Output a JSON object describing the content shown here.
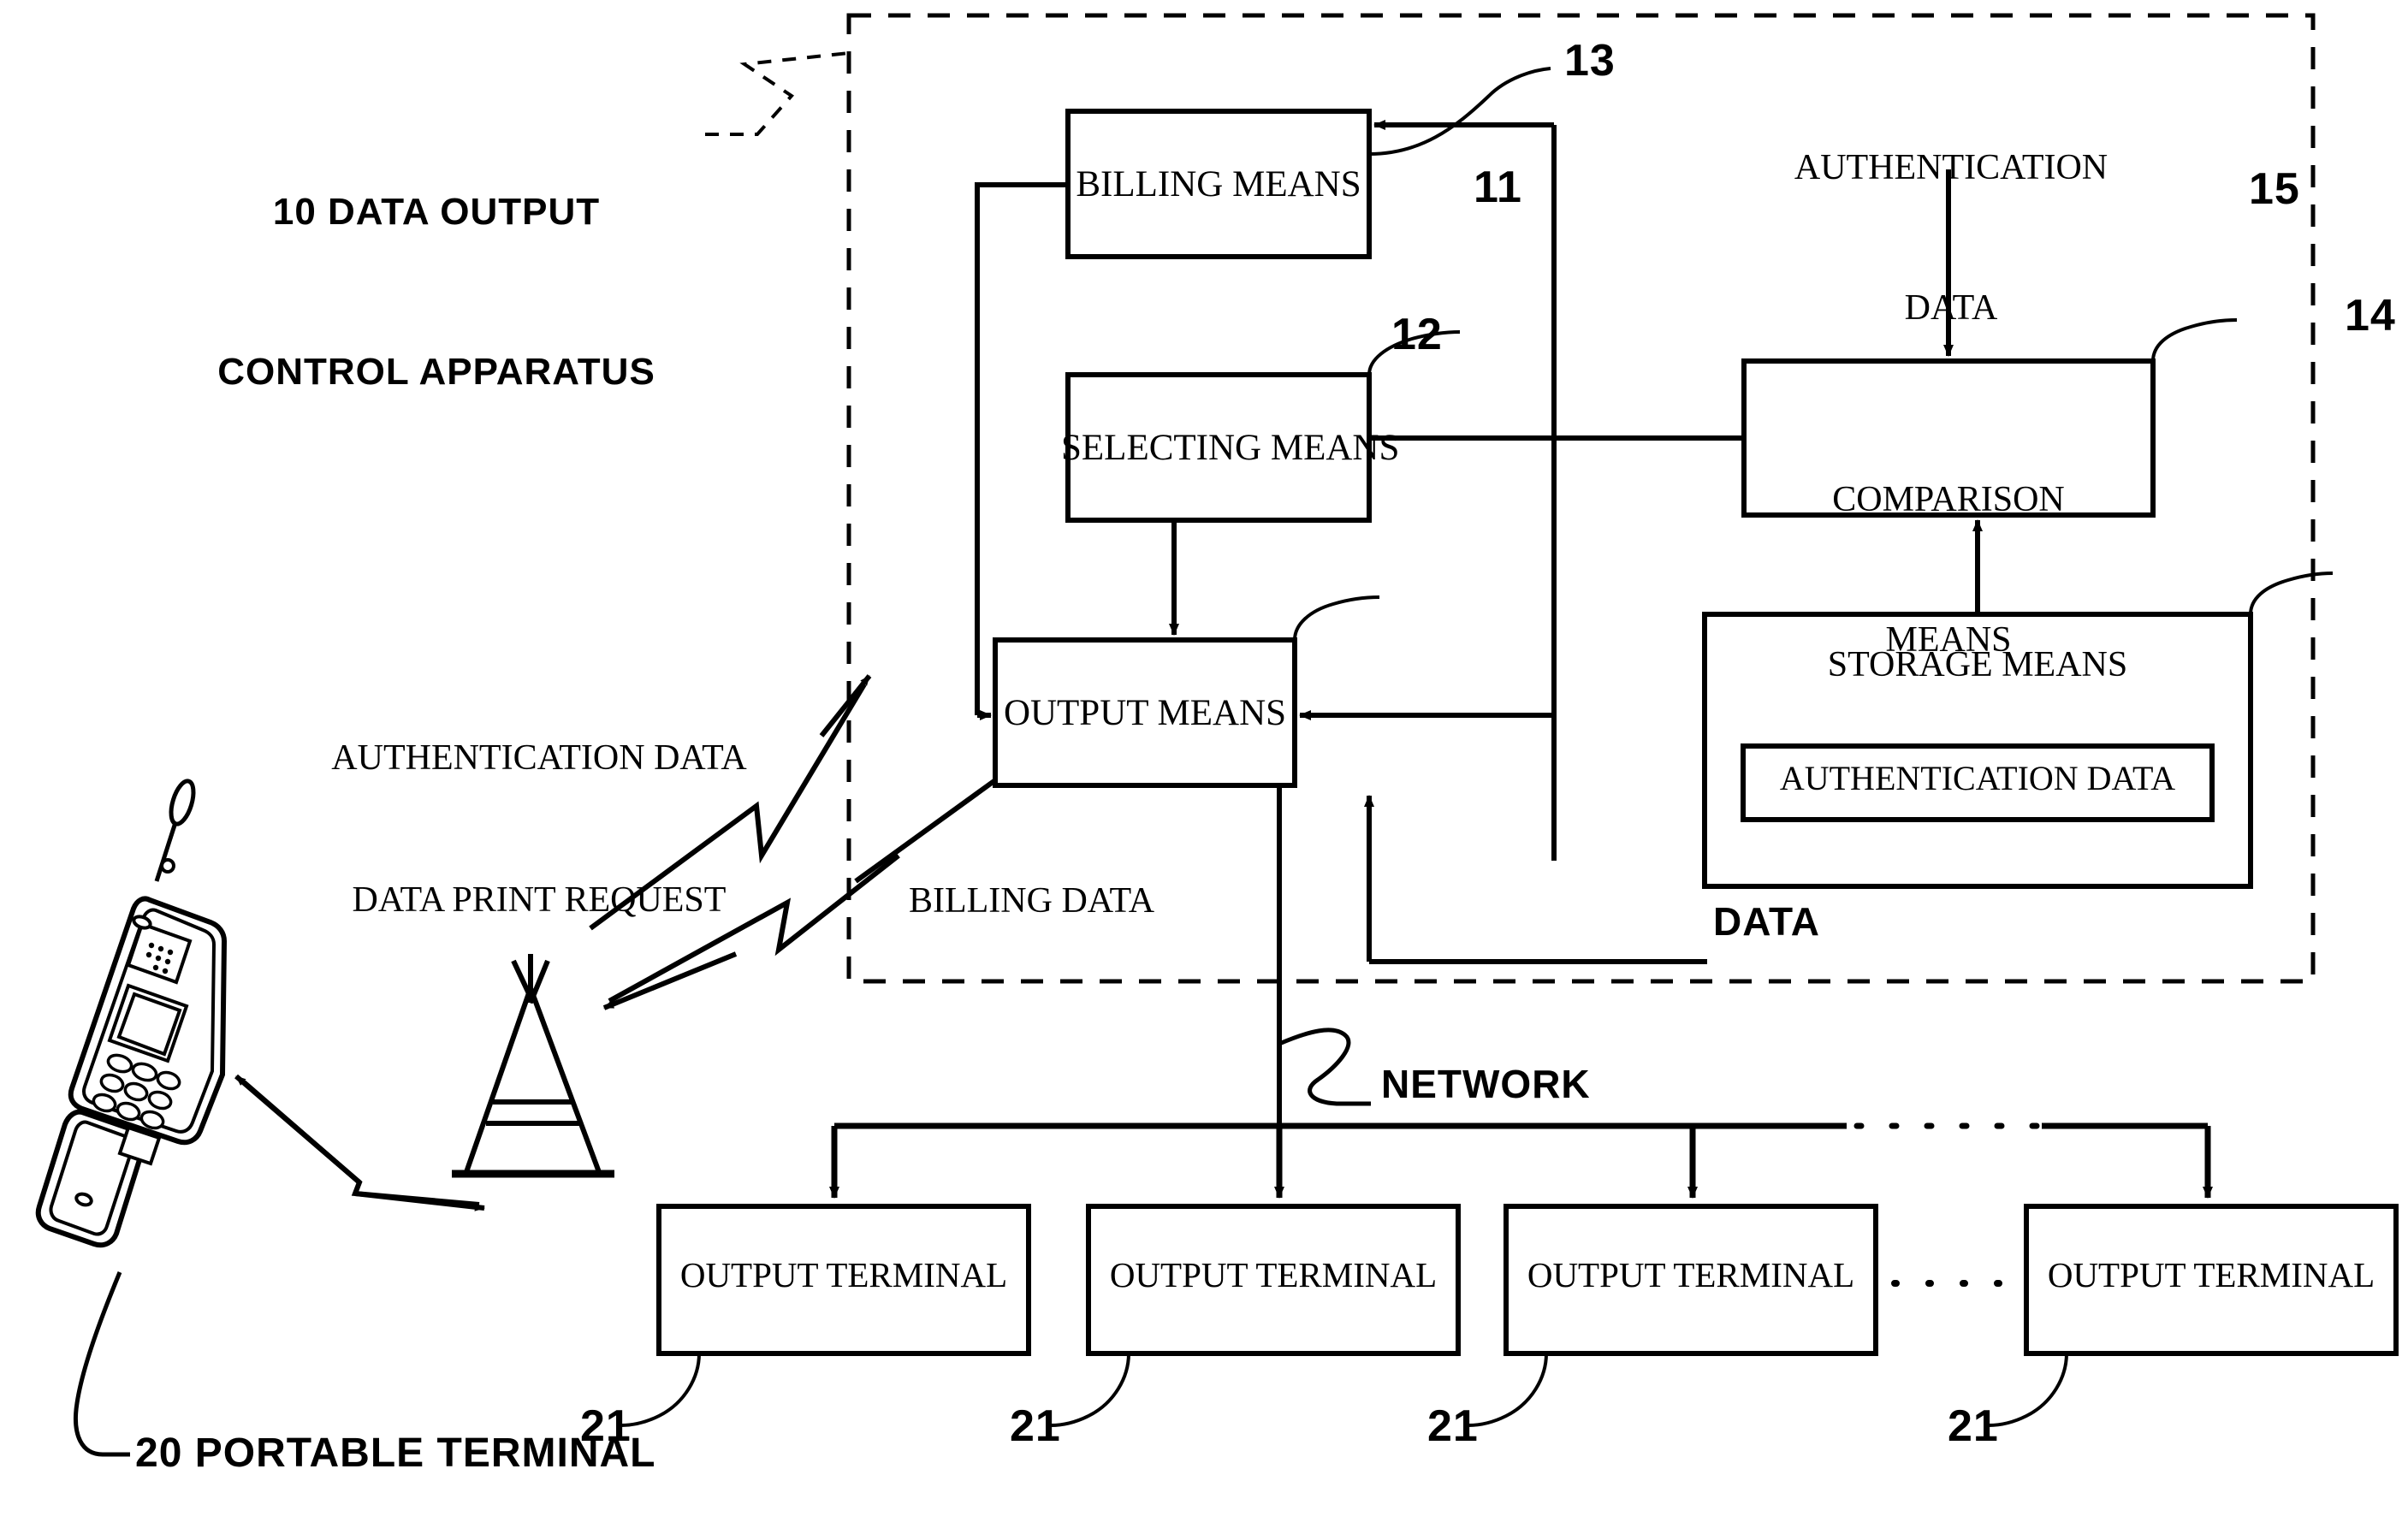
{
  "figure": {
    "apparatus_label": "10 DATA OUTPUT\nCONTROL APPARATUS",
    "apparatus_label_line1": "10 DATA OUTPUT",
    "apparatus_label_line2": "CONTROL APPARATUS",
    "portable_terminal_label": "20 PORTABLE TERMINAL",
    "network_label": "NETWORK",
    "data_label": "DATA",
    "billing_data_label": "BILLING DATA",
    "request_label_line1": "AUTHENTICATION DATA",
    "request_label_line2": "DATA PRINT REQUEST",
    "auth_data_input_line1": "AUTHENTICATION",
    "auth_data_input_line2": "DATA"
  },
  "blocks": {
    "billing_means": {
      "label": "BILLING MEANS",
      "ref": "13"
    },
    "selecting_means": {
      "label": "SELECTING MEANS",
      "ref": "11"
    },
    "output_means": {
      "label": "OUTPUT MEANS",
      "ref": "12"
    },
    "comparison_means": {
      "label_line1": "COMPARISON",
      "label_line2": "MEANS",
      "ref": "15"
    },
    "storage_means": {
      "label": "STORAGE MEANS",
      "ref": "14",
      "inner_label": "AUTHENTICATION DATA"
    }
  },
  "terminals": [
    {
      "label": "OUTPUT TERMINAL",
      "ref": "21"
    },
    {
      "label": "OUTPUT TERMINAL",
      "ref": "21"
    },
    {
      "label": "OUTPUT TERMINAL",
      "ref": "21"
    },
    {
      "label": "OUTPUT TERMINAL",
      "ref": "21"
    }
  ],
  "colors": {
    "ink": "#000000",
    "paper": "#ffffff"
  }
}
